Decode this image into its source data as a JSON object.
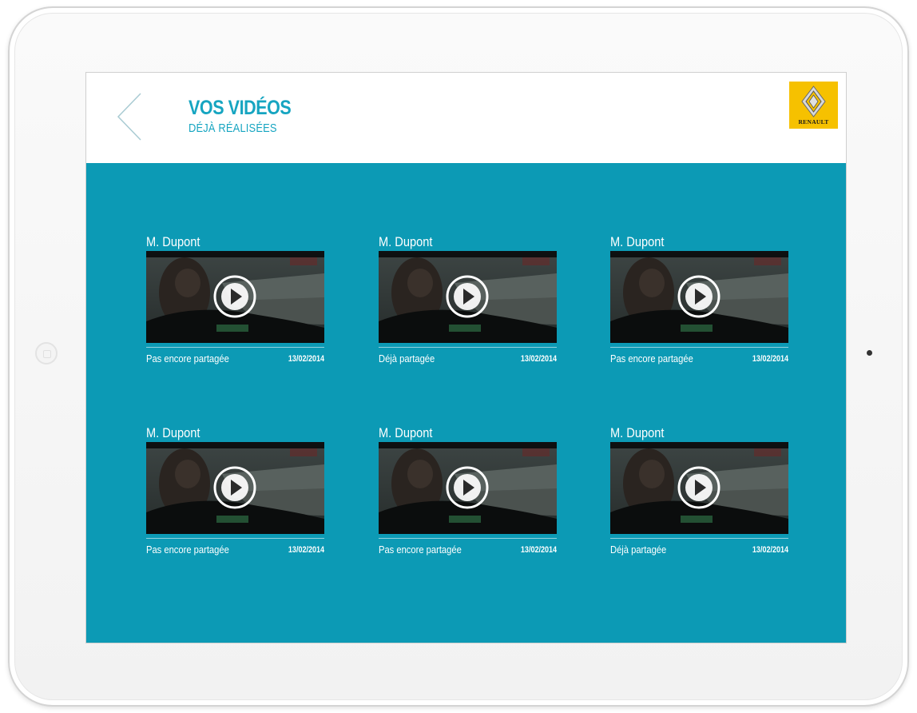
{
  "header": {
    "title": "VOS VIDÉOS",
    "subtitle": "DÉJÀ RÉALISÉES",
    "brand": "RENAULT"
  },
  "colors": {
    "accent": "#16a5c1",
    "content_background": "#0c9ab5",
    "brand_yellow": "#f6c100"
  },
  "videos": [
    {
      "owner": "M. Dupont",
      "status": "Pas encore partagée",
      "date": "13/02/2014"
    },
    {
      "owner": "M. Dupont",
      "status": "Déjà partagée",
      "date": "13/02/2014"
    },
    {
      "owner": "M. Dupont",
      "status": "Pas encore partagée",
      "date": "13/02/2014"
    },
    {
      "owner": "M. Dupont",
      "status": "Pas encore partagée",
      "date": "13/02/2014"
    },
    {
      "owner": "M. Dupont",
      "status": "Pas encore partagée",
      "date": "13/02/2014"
    },
    {
      "owner": "M. Dupont",
      "status": "Déjà partagée",
      "date": "13/02/2014"
    }
  ]
}
